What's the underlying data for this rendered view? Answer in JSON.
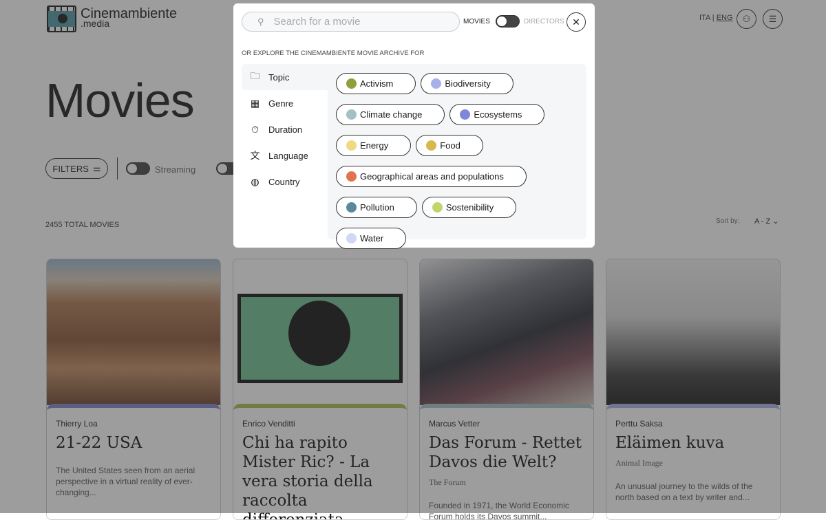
{
  "header": {
    "logo_name": "Cinemambiente",
    "logo_sub": ".media",
    "lang_ita": "ITA",
    "lang_sep": "|",
    "lang_eng": "ENG"
  },
  "page": {
    "title": "Movies",
    "filters_label": "FILTERS",
    "streaming_label": "Streaming",
    "total": "2455 TOTAL MOVIES",
    "sort_label": "Sort by:",
    "sort_value": "A - Z"
  },
  "cards": [
    {
      "director": "Thierry Loa",
      "title": "21-22 USA",
      "original": "",
      "description": "The United States seen from an aerial perspective in a virtual reality of ever-changing...",
      "color": "#7d84c8"
    },
    {
      "director": "Enrico Venditti",
      "title": "Chi ha rapito Mister Ric? - La vera storia della raccolta differenziata",
      "original": "",
      "description": "",
      "color": "#a9bc4e"
    },
    {
      "director": "Marcus Vetter",
      "title": "Das Forum - Rettet Davos die Welt?",
      "original": "The Forum",
      "description": "Founded in 1971, the World Economic Forum holds its Davos summit...",
      "color": "#a5c3c4"
    },
    {
      "director": "Perttu Saksa",
      "title": "Eläimen kuva",
      "original": "Animal Image",
      "description": "An unusual journey to the wilds of the north based on a text by writer and...",
      "color": "#aab0e6"
    }
  ],
  "modal": {
    "search_placeholder": "Search for a movie",
    "movies_label": "MOVIES",
    "directors_label": "DIRECTORS",
    "explore_label": "OR EXPLORE THE CINEMAMBIENTE MOVIE ARCHIVE FOR",
    "categories": [
      {
        "label": "Topic",
        "icon": "folder-icon"
      },
      {
        "label": "Genre",
        "icon": "film-icon"
      },
      {
        "label": "Duration",
        "icon": "stopwatch-icon"
      },
      {
        "label": "Language",
        "icon": "translate-icon"
      },
      {
        "label": "Country",
        "icon": "globe-icon"
      }
    ],
    "topics": [
      {
        "label": "Activism",
        "color": "#8da03c"
      },
      {
        "label": "Biodiversity",
        "color": "#a7b0e8"
      },
      {
        "label": "Climate change",
        "color": "#a3c0c4"
      },
      {
        "label": "Ecosystems",
        "color": "#7f88d8"
      },
      {
        "label": "Energy",
        "color": "#efd982"
      },
      {
        "label": "Food",
        "color": "#d6b84e"
      },
      {
        "label": "Geographical areas and populations",
        "color": "#e07450"
      },
      {
        "label": "Pollution",
        "color": "#5a8a9a"
      },
      {
        "label": "Sostenibility",
        "color": "#c2d46c"
      },
      {
        "label": "Water",
        "color": "#cfd8f4"
      }
    ]
  }
}
